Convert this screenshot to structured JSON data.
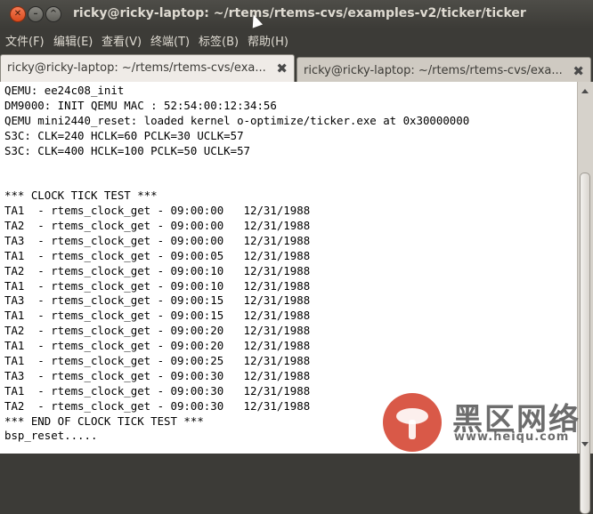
{
  "window": {
    "title": "ricky@ricky-laptop: ~/rtems/rtems-cvs/examples-v2/ticker/ticker"
  },
  "menu": {
    "items": [
      {
        "label": "文件(F)"
      },
      {
        "label": "编辑(E)"
      },
      {
        "label": "查看(V)"
      },
      {
        "label": "终端(T)"
      },
      {
        "label": "标签(B)"
      },
      {
        "label": "帮助(H)"
      }
    ]
  },
  "tabs": [
    {
      "label": "ricky@ricky-laptop: ~/rtems/rtems-cvs/exa...",
      "active": true
    },
    {
      "label": "ricky@ricky-laptop: ~/rtems/rtems-cvs/exa...",
      "active": false
    }
  ],
  "terminal": {
    "lines": [
      "QEMU: ee24c08_init",
      "DM9000: INIT QEMU MAC : 52:54:00:12:34:56",
      "QEMU mini2440_reset: loaded kernel o-optimize/ticker.exe at 0x30000000",
      "S3C: CLK=240 HCLK=60 PCLK=30 UCLK=57",
      "S3C: CLK=400 HCLK=100 PCLK=50 UCLK=57",
      "",
      "",
      "*** CLOCK TICK TEST ***",
      "TA1  - rtems_clock_get - 09:00:00   12/31/1988",
      "TA2  - rtems_clock_get - 09:00:00   12/31/1988",
      "TA3  - rtems_clock_get - 09:00:00   12/31/1988",
      "TA1  - rtems_clock_get - 09:00:05   12/31/1988",
      "TA2  - rtems_clock_get - 09:00:10   12/31/1988",
      "TA1  - rtems_clock_get - 09:00:10   12/31/1988",
      "TA3  - rtems_clock_get - 09:00:15   12/31/1988",
      "TA1  - rtems_clock_get - 09:00:15   12/31/1988",
      "TA2  - rtems_clock_get - 09:00:20   12/31/1988",
      "TA1  - rtems_clock_get - 09:00:20   12/31/1988",
      "TA1  - rtems_clock_get - 09:00:25   12/31/1988",
      "TA3  - rtems_clock_get - 09:00:30   12/31/1988",
      "TA1  - rtems_clock_get - 09:00:30   12/31/1988",
      "TA2  - rtems_clock_get - 09:00:30   12/31/1988",
      "*** END OF CLOCK TICK TEST ***",
      "bsp_reset....."
    ]
  },
  "watermark": {
    "cn_text": "黑区网络",
    "url_text": "www.heiqu.com"
  },
  "icons": {
    "close": "close-icon",
    "minimize": "minimize-icon",
    "maximize": "maximize-icon",
    "tab_close": "tab-close-icon",
    "scroll_up": "scroll-up-arrow-icon",
    "scroll_down": "scroll-down-arrow-icon"
  }
}
